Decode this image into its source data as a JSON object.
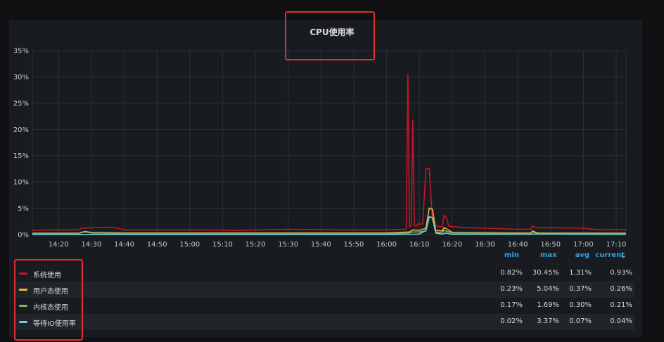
{
  "panel": {
    "title": "CPU使用率"
  },
  "chart_data": {
    "type": "line",
    "title": "CPU使用率",
    "xlabel": "",
    "ylabel": "",
    "ylim": [
      0,
      35
    ],
    "y_ticks": [
      "0%",
      "5%",
      "10%",
      "15%",
      "20%",
      "25%",
      "30%",
      "35%"
    ],
    "x_ticks": [
      "14:20",
      "14:30",
      "14:40",
      "14:50",
      "15:00",
      "15:10",
      "15:20",
      "15:30",
      "15:40",
      "15:50",
      "16:00",
      "16:10",
      "16:20",
      "16:30",
      "16:40",
      "16:50",
      "17:00",
      "17:10"
    ],
    "x_range": [
      "14:12",
      "17:13"
    ],
    "grid": true,
    "series": [
      {
        "name": "系统使用",
        "color": "#c4162a",
        "x": [
          "14:12",
          "14:20",
          "14:26",
          "14:27",
          "14:30",
          "14:35",
          "14:38",
          "14:40",
          "15:00",
          "15:15",
          "15:30",
          "15:45",
          "16:00",
          "16:06",
          "16:06.5",
          "16:07",
          "16:07.5",
          "16:08",
          "16:08.5",
          "16:09",
          "16:09.5",
          "16:10",
          "16:11",
          "16:12",
          "16:13",
          "16:14",
          "16:15",
          "16:16",
          "16:17",
          "16:17.5",
          "16:18",
          "16:19",
          "16:20",
          "16:25",
          "16:30",
          "16:40",
          "16:44",
          "16:44.5",
          "16:46",
          "16:50",
          "17:00",
          "17:05",
          "17:13"
        ],
        "values": [
          0.8,
          0.9,
          0.9,
          1.2,
          1.3,
          1.4,
          1.2,
          0.9,
          0.9,
          0.8,
          1.0,
          0.9,
          0.9,
          1.0,
          30.45,
          1.5,
          1.6,
          21.8,
          1.8,
          1.5,
          2.0,
          2.0,
          2.0,
          12.6,
          12.6,
          2.5,
          1.7,
          1.5,
          1.5,
          3.6,
          3.5,
          1.6,
          1.5,
          1.3,
          1.2,
          1.0,
          1.0,
          1.6,
          1.3,
          1.3,
          1.2,
          0.9,
          0.93
        ]
      },
      {
        "name": "用户态使用",
        "color": "#eab839",
        "x": [
          "14:12",
          "14:26",
          "14:28",
          "14:30",
          "14:40",
          "15:00",
          "16:00",
          "16:07",
          "16:08",
          "16:10",
          "16:12",
          "16:13",
          "16:14",
          "16:15",
          "16:17",
          "16:17.5",
          "16:18",
          "16:20",
          "16:40",
          "16:44",
          "16:44.5",
          "16:46",
          "17:13"
        ],
        "values": [
          0.25,
          0.25,
          0.6,
          0.4,
          0.3,
          0.3,
          0.3,
          0.5,
          0.9,
          0.8,
          1.2,
          5.04,
          4.8,
          0.8,
          0.7,
          1.3,
          1.2,
          0.4,
          0.3,
          0.3,
          0.7,
          0.3,
          0.26
        ]
      },
      {
        "name": "内核态使用",
        "color": "#7eb26d",
        "x": [
          "14:12",
          "14:26",
          "14:28",
          "14:30",
          "14:40",
          "15:00",
          "16:00",
          "16:07",
          "16:08",
          "16:10",
          "16:12",
          "16:13",
          "16:14",
          "16:15",
          "16:17",
          "16:17.5",
          "16:18",
          "16:20",
          "16:40",
          "16:44",
          "16:44.5",
          "16:46",
          "17:13"
        ],
        "values": [
          0.2,
          0.2,
          0.5,
          0.3,
          0.2,
          0.2,
          0.2,
          0.3,
          0.5,
          0.5,
          0.7,
          3.4,
          3.2,
          0.5,
          0.4,
          0.8,
          0.7,
          0.3,
          0.2,
          0.2,
          0.5,
          0.2,
          0.21
        ]
      },
      {
        "name": "等待IO使用率",
        "color": "#6ed0e0",
        "x": [
          "14:12",
          "15:00",
          "16:00",
          "16:08",
          "16:10",
          "16:12",
          "16:13",
          "16:14",
          "16:15",
          "16:17",
          "16:18",
          "16:20",
          "16:44",
          "16:45",
          "17:13"
        ],
        "values": [
          0.03,
          0.03,
          0.03,
          0.05,
          0.1,
          0.8,
          3.37,
          3.2,
          0.3,
          0.1,
          0.3,
          0.05,
          0.05,
          0.1,
          0.04
        ]
      }
    ]
  },
  "legend": {
    "headers": {
      "min": "min",
      "max": "max",
      "avg": "avg",
      "current": "current"
    },
    "chevron": "chevron-down-icon",
    "rows": [
      {
        "name": "系统使用",
        "color": "#c4162a",
        "min": "0.82%",
        "max": "30.45%",
        "avg": "1.31%",
        "current": "0.93%"
      },
      {
        "name": "用户态使用",
        "color": "#eab839",
        "min": "0.23%",
        "max": "5.04%",
        "avg": "0.37%",
        "current": "0.26%"
      },
      {
        "name": "内核态使用",
        "color": "#7eb26d",
        "min": "0.17%",
        "max": "1.69%",
        "avg": "0.30%",
        "current": "0.21%"
      },
      {
        "name": "等待IO使用率",
        "color": "#6ed0e0",
        "min": "0.02%",
        "max": "3.37%",
        "avg": "0.07%",
        "current": "0.04%"
      }
    ]
  }
}
